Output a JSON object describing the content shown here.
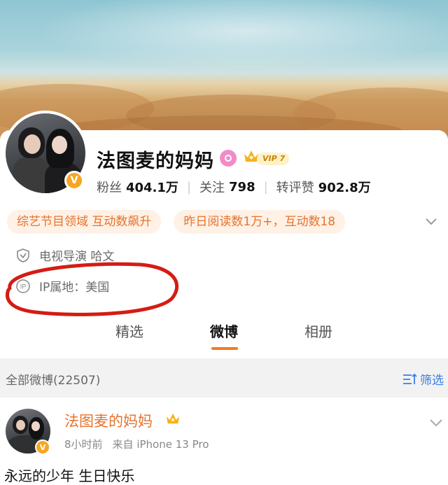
{
  "profile": {
    "name": "法图麦的妈妈",
    "vip_label": "VIP 7",
    "verified_mark": "V",
    "stats": [
      {
        "label": "粉丝",
        "value": "404.1万"
      },
      {
        "label": "关注",
        "value": "798"
      },
      {
        "label": "转评赞",
        "value": "902.8万"
      }
    ],
    "tags": [
      "综艺节目领域 互动数飙升",
      "昨日阅读数1万+，互动数18"
    ],
    "description": "电视导演 哈文",
    "ip_location": "IP属地：美国"
  },
  "tabs": [
    {
      "label": "精选",
      "active": false
    },
    {
      "label": "微博",
      "active": true
    },
    {
      "label": "相册",
      "active": false
    }
  ],
  "feed": {
    "count_label": "全部微博(22507)",
    "filter_label": "筛选"
  },
  "post": {
    "author": "法图麦的妈妈",
    "time": "8小时前",
    "source": "来自 iPhone 13 Pro",
    "text": "永远的少年 生日快乐"
  },
  "colors": {
    "accent_orange": "#f47a1f",
    "tag_text": "#e6732c",
    "link_blue": "#3a7ee4",
    "annotation_red": "#d41c14"
  },
  "icons": [
    "search-badge-icon",
    "crown-icon",
    "chevron-down-icon",
    "shield-icon",
    "ip-icon",
    "filter-icon",
    "verified-v-icon"
  ]
}
